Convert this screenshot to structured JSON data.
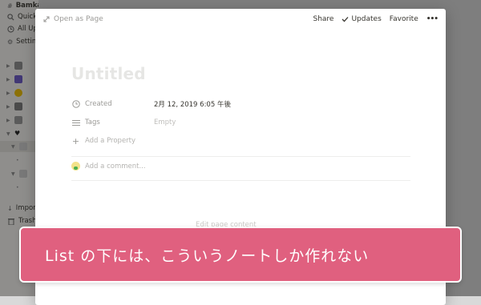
{
  "sidebar": {
    "workspace": "Bamka",
    "nav": [
      {
        "label": "Quick Find",
        "icon": "search-icon"
      },
      {
        "label": "All Updates",
        "icon": "clock-icon"
      },
      {
        "label": "Settings",
        "icon": "gear-icon"
      }
    ],
    "bottom": [
      {
        "label": "Import",
        "icon": "import-icon"
      },
      {
        "label": "Trash",
        "icon": "trash-icon"
      }
    ]
  },
  "modal": {
    "open_as_page": "Open as Page",
    "share": "Share",
    "updates": "Updates",
    "favorite": "Favorite",
    "more": "•••",
    "title_placeholder": "Untitled",
    "properties": [
      {
        "label": "Created",
        "value": "2月 12, 2019 6:05 午後",
        "icon": "clock-icon"
      },
      {
        "label": "Tags",
        "value": "Empty",
        "icon": "list-icon"
      }
    ],
    "add_property": "Add a Property",
    "add_comment": "Add a comment...",
    "edit_hint": "Edit page content"
  },
  "banner": {
    "text": "List の下には、こういうノートしか作れない"
  },
  "colors": {
    "banner": "#e0607f",
    "overlay": "rgba(15,15,15,0.45)"
  }
}
